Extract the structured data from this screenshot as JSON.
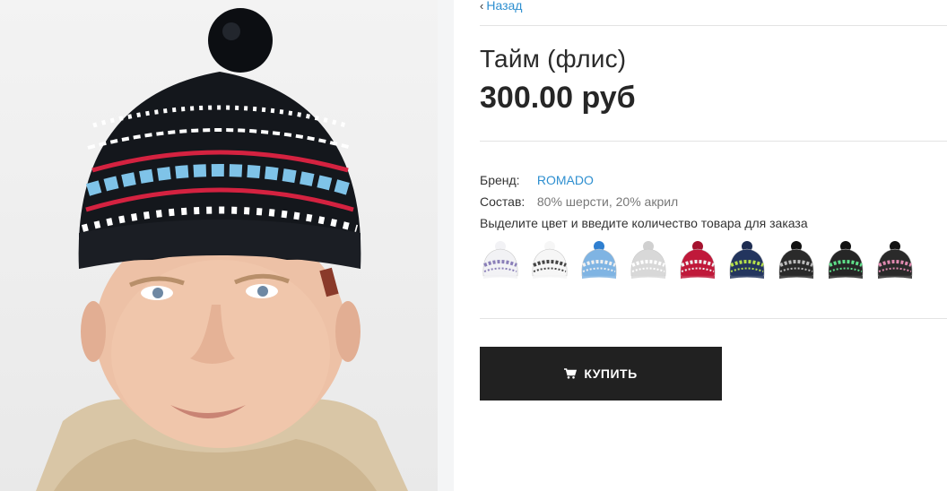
{
  "nav": {
    "back_label": "Назад"
  },
  "product": {
    "title": "Тайм (флис)",
    "price": "300.00 руб",
    "properties": [
      {
        "key": "Бренд:",
        "value": "ROMADO",
        "is_link": true
      },
      {
        "key": "Состав:",
        "value": "80% шерсти, 20% акрил",
        "is_link": false
      }
    ],
    "variant_hint": "Выделите цвет и введите количество товара для заказа",
    "variants": [
      {
        "name": "white-purple",
        "base": "#f2f2f5",
        "band": "#8a7fb8",
        "pom": "#f2f2f5"
      },
      {
        "name": "white-black",
        "base": "#f6f6f6",
        "band": "#444444",
        "pom": "#f6f6f6"
      },
      {
        "name": "light-blue",
        "base": "#7fb4e3",
        "band": "#f0f0f0",
        "pom": "#2f7fd0"
      },
      {
        "name": "grey",
        "base": "#d8d8d8",
        "band": "#ffffff",
        "pom": "#d0d0d0"
      },
      {
        "name": "red",
        "base": "#c0193a",
        "band": "#f0f0f0",
        "pom": "#a5122e"
      },
      {
        "name": "navy-lime",
        "base": "#23355e",
        "band": "#b6e04a",
        "pom": "#1e2d52"
      },
      {
        "name": "black-grey",
        "base": "#2a2a2a",
        "band": "#bdbdbd",
        "pom": "#111111"
      },
      {
        "name": "black-green",
        "base": "#262626",
        "band": "#5fe08a",
        "pom": "#111111"
      },
      {
        "name": "black-pink",
        "base": "#2a2a2a",
        "band": "#e08ab0",
        "pom": "#111111"
      }
    ]
  },
  "cart": {
    "buy_label": "КУПИТЬ",
    "icon": "cart-icon"
  },
  "colors": {
    "accent": "#2e8fd0",
    "button": "#212121",
    "text": "#222222"
  }
}
